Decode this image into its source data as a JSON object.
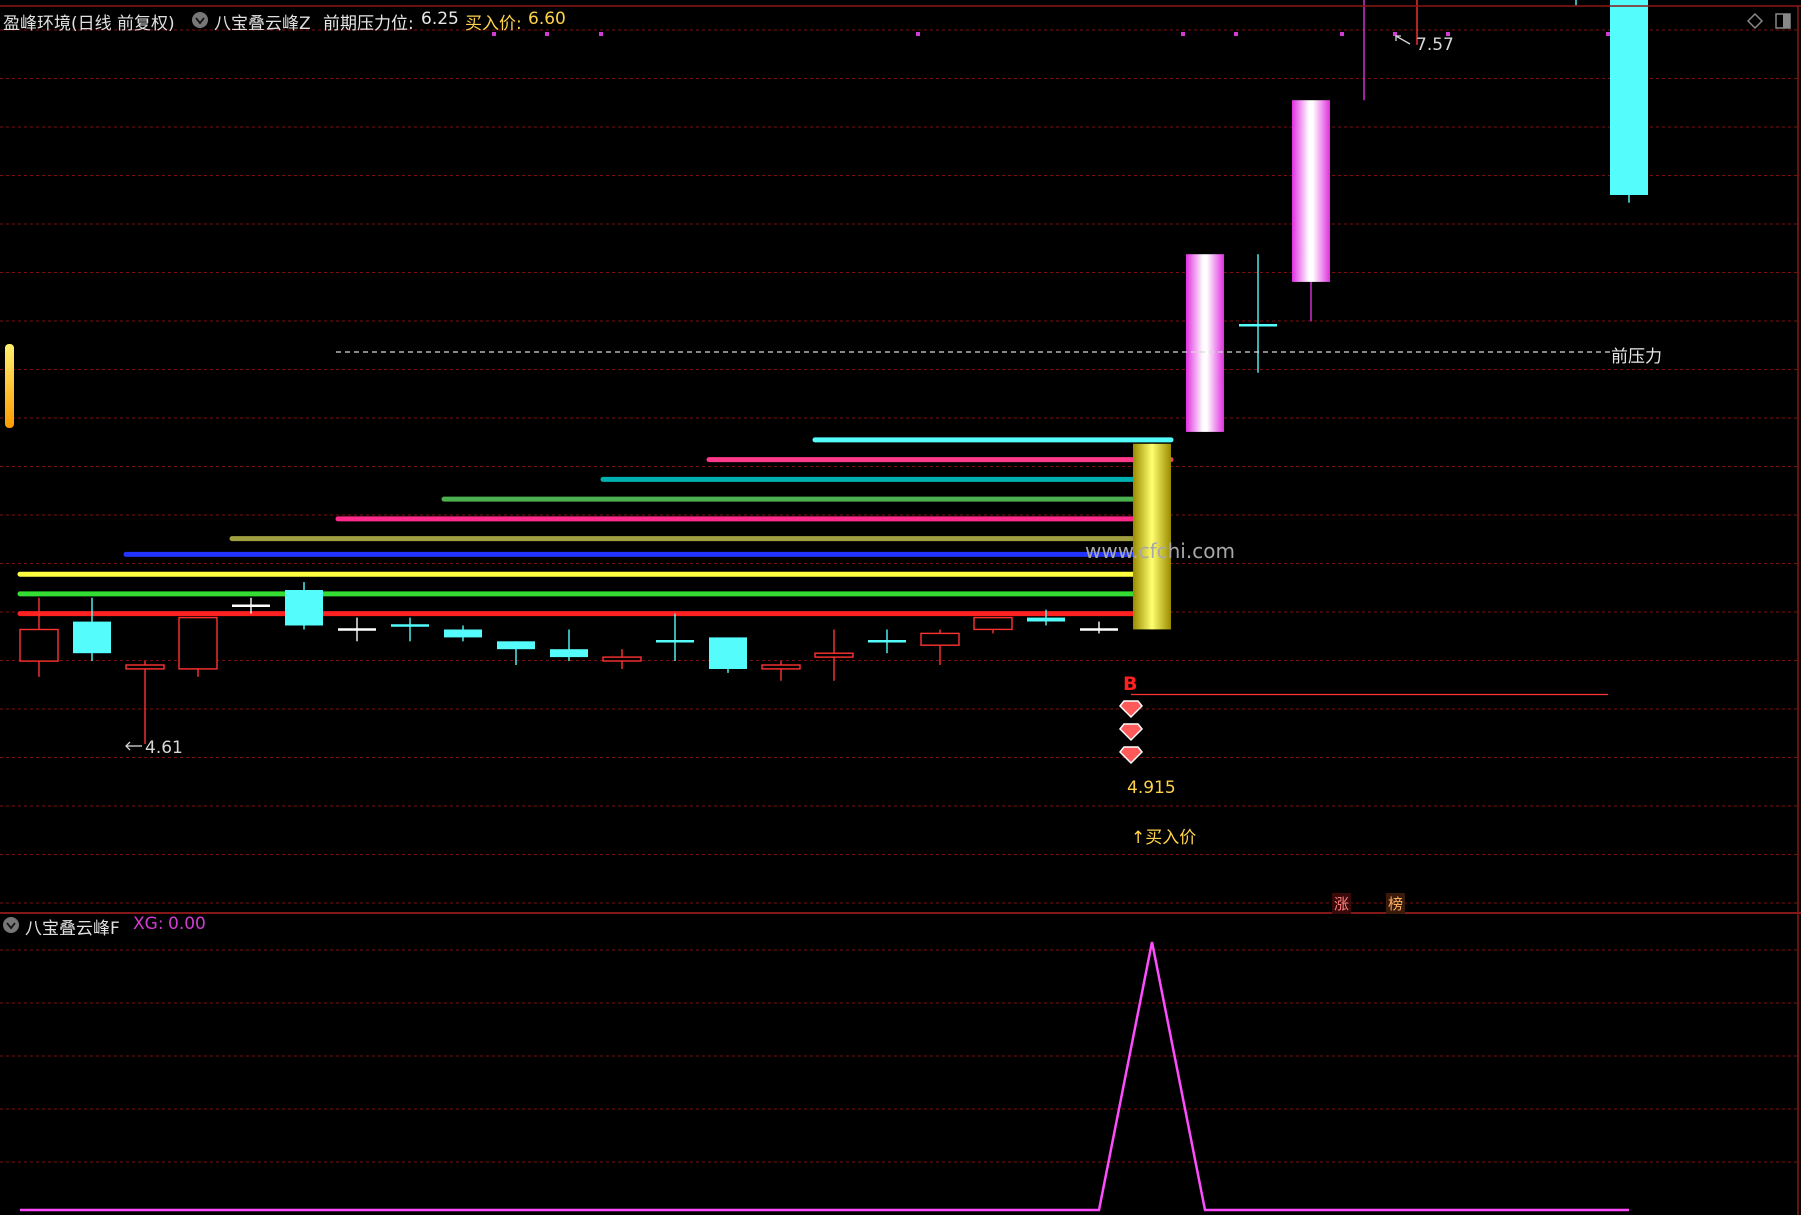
{
  "header": {
    "stock_label": "盈峰环境(日线 前复权)",
    "indicator_name": "八宝叠云峰Z",
    "pressure_label": "前期压力位:",
    "pressure_value": "6.25",
    "buy_label": "买入价:",
    "buy_value": "6.60"
  },
  "sub_header": {
    "indicator_name": "八宝叠云峰F",
    "xg_label": "XG:",
    "xg_value": "0.00"
  },
  "annotations": {
    "high_label": "7.57",
    "low_label": "4.61",
    "pressure_line_label": "前压力",
    "buy_price_value": "4.915",
    "buy_price_label": "↑买入价",
    "buy_marker": "B",
    "watermark": "www.cfchi.com",
    "badge_zhang": "涨",
    "badge_bang": "榜"
  },
  "colors": {
    "background": "#000000",
    "up": "#ff3232",
    "down": "#54fcfc",
    "grid": "#7a1010",
    "header_text": "#e0e0e0",
    "buy_text": "#ffd24a",
    "xg_text": "#d23cd2",
    "magenta": "#ff4cff",
    "gold": "#e8d020"
  },
  "candles": [
    {
      "o": 4.9,
      "h": 4.98,
      "l": 4.78,
      "c": 4.82,
      "style": "up"
    },
    {
      "o": 4.92,
      "h": 4.98,
      "l": 4.82,
      "c": 4.84,
      "style": "down"
    },
    {
      "o": 4.8,
      "h": 4.82,
      "l": 4.61,
      "c": 4.81,
      "style": "up"
    },
    {
      "o": 4.8,
      "h": 4.92,
      "l": 4.78,
      "c": 4.93,
      "style": "up"
    },
    {
      "o": 4.96,
      "h": 4.98,
      "l": 4.94,
      "c": 4.96,
      "style": "flat"
    },
    {
      "o": 5.0,
      "h": 5.02,
      "l": 4.9,
      "c": 4.91,
      "style": "down"
    },
    {
      "o": 4.9,
      "h": 4.93,
      "l": 4.87,
      "c": 4.9,
      "style": "flat"
    },
    {
      "o": 4.91,
      "h": 4.93,
      "l": 4.87,
      "c": 4.91,
      "style": "flatdown"
    },
    {
      "o": 4.9,
      "h": 4.91,
      "l": 4.87,
      "c": 4.88,
      "style": "down"
    },
    {
      "o": 4.87,
      "h": 4.87,
      "l": 4.81,
      "c": 4.85,
      "style": "down"
    },
    {
      "o": 4.85,
      "h": 4.9,
      "l": 4.82,
      "c": 4.83,
      "style": "down"
    },
    {
      "o": 4.83,
      "h": 4.85,
      "l": 4.8,
      "c": 4.82,
      "style": "up"
    },
    {
      "o": 4.87,
      "h": 4.94,
      "l": 4.82,
      "c": 4.87,
      "style": "flatdown"
    },
    {
      "o": 4.88,
      "h": 4.88,
      "l": 4.79,
      "c": 4.8,
      "style": "down"
    },
    {
      "o": 4.81,
      "h": 4.82,
      "l": 4.77,
      "c": 4.8,
      "style": "up"
    },
    {
      "o": 4.83,
      "h": 4.9,
      "l": 4.77,
      "c": 4.84,
      "style": "up"
    },
    {
      "o": 4.87,
      "h": 4.9,
      "l": 4.84,
      "c": 4.87,
      "style": "flatdown"
    },
    {
      "o": 4.86,
      "h": 4.9,
      "l": 4.81,
      "c": 4.89,
      "style": "up"
    },
    {
      "o": 4.9,
      "h": 4.93,
      "l": 4.89,
      "c": 4.93,
      "style": "up"
    },
    {
      "o": 4.93,
      "h": 4.95,
      "l": 4.91,
      "c": 4.92,
      "style": "down"
    },
    {
      "o": 4.9,
      "h": 4.92,
      "l": 4.89,
      "c": 4.9,
      "style": "flat"
    },
    {
      "o": 4.9,
      "h": 5.37,
      "l": 4.9,
      "c": 5.37,
      "style": "gold"
    },
    {
      "o": 5.4,
      "h": 5.4,
      "l": 5.4,
      "c": 5.85,
      "style": "magenta"
    },
    {
      "o": 5.67,
      "h": 5.85,
      "l": 5.55,
      "c": 5.67,
      "style": "flatdown"
    },
    {
      "o": 5.78,
      "h": 5.88,
      "l": 5.68,
      "c": 6.24,
      "style": "magenta"
    },
    {
      "o": 6.68,
      "h": 6.68,
      "l": 6.24,
      "c": 6.89,
      "style": "magenta"
    },
    {
      "o": 6.73,
      "h": 7.57,
      "l": 6.38,
      "c": 7.06,
      "style": "up"
    },
    {
      "o": 6.74,
      "h": 7.39,
      "l": 6.65,
      "c": 7.04,
      "style": "up"
    },
    {
      "o": 6.95,
      "h": 7.53,
      "l": 6.85,
      "c": 6.98,
      "style": "up"
    },
    {
      "o": 6.87,
      "h": 6.94,
      "l": 6.48,
      "c": 6.54,
      "style": "down"
    },
    {
      "o": 6.56,
      "h": 6.62,
      "l": 5.98,
      "c": 6.0,
      "style": "down"
    }
  ],
  "ribbons": [
    {
      "price": 5.38,
      "start": 15,
      "color": "#54fcfc"
    },
    {
      "price": 5.33,
      "start": 13,
      "color": "#ff3a8a"
    },
    {
      "price": 5.28,
      "start": 11,
      "color": "#00b0b0"
    },
    {
      "price": 5.23,
      "start": 8,
      "color": "#4caf50"
    },
    {
      "price": 5.18,
      "start": 6,
      "color": "#ff2a8a"
    },
    {
      "price": 5.13,
      "start": 4,
      "color": "#a0a040"
    },
    {
      "price": 5.09,
      "start": 2,
      "color": "#2233ff"
    },
    {
      "price": 5.04,
      "start": 0,
      "color": "#ffff40"
    },
    {
      "price": 4.99,
      "start": 0,
      "color": "#33dd33"
    },
    {
      "price": 4.94,
      "start": 0,
      "color": "#ff2020"
    }
  ],
  "chart_data": {
    "type": "line",
    "xg_series": [
      0,
      0,
      0,
      0,
      0,
      0,
      0,
      0,
      0,
      0,
      0,
      0,
      0,
      0,
      0,
      0,
      0,
      0,
      0,
      0,
      0,
      1,
      0,
      0,
      0,
      0,
      0,
      0,
      0,
      0,
      0
    ],
    "ylim": [
      0,
      1
    ]
  }
}
